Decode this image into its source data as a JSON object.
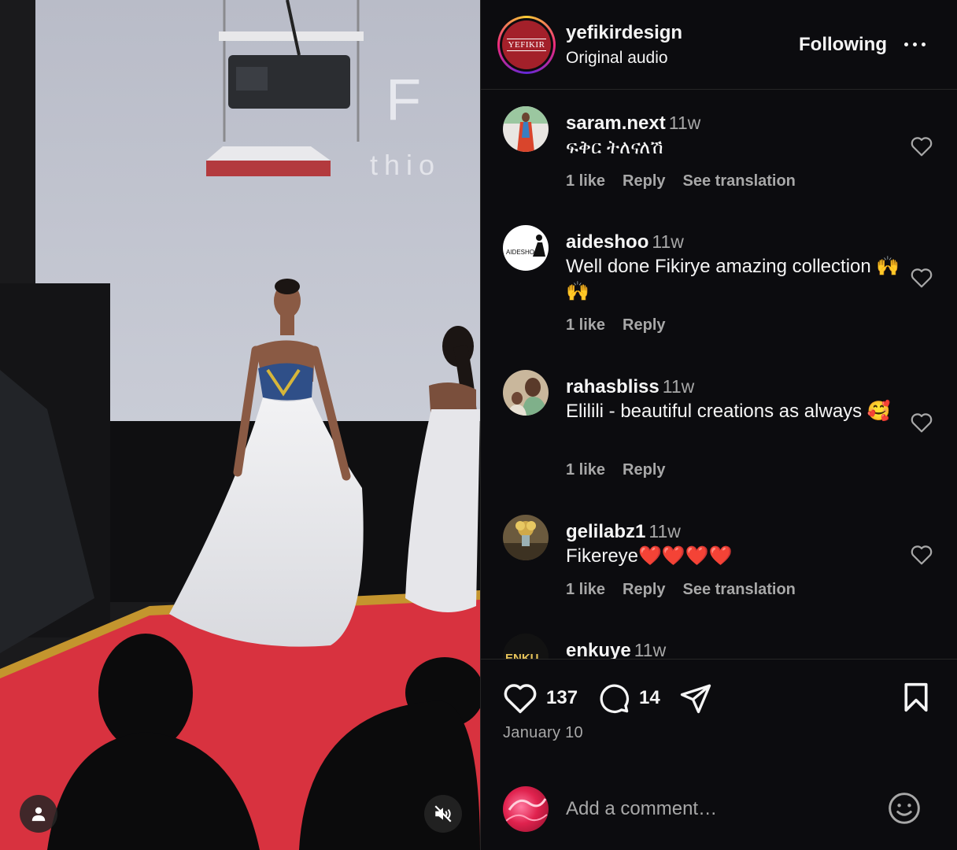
{
  "header": {
    "username": "yefikirdesign",
    "audio": "Original audio",
    "follow_label": "Following",
    "avatar_text": "YEFIKIR"
  },
  "video": {
    "backdrop_letters": "F I",
    "backdrop_sub": "thio",
    "tag_icon": "user-icon",
    "mute_icon": "speaker-muted-icon"
  },
  "comments": [
    {
      "user": "saram.next",
      "time": "11w",
      "text": "ፍቅር ትለናለሽ",
      "likes": "1 like",
      "reply": "Reply",
      "translate": "See translation"
    },
    {
      "user": "aideshoo",
      "time": "11w",
      "text": "Well done Fikirye amazing collection 🙌🙌",
      "likes": "1 like",
      "reply": "Reply",
      "translate": ""
    },
    {
      "user": "rahasbliss",
      "time": "11w",
      "text": "Elilili - beautiful creations as always 🥰",
      "likes": "1 like",
      "reply": "Reply",
      "translate": ""
    },
    {
      "user": "gelilabz1",
      "time": "11w",
      "text": "Fikereye❤️❤️❤️❤️",
      "likes": "1 like",
      "reply": "Reply",
      "translate": "See translation"
    },
    {
      "user": "enkuye",
      "time": "11w",
      "avatar_text": "ENKU"
    }
  ],
  "actions": {
    "likes_count": "137",
    "comments_count": "14",
    "date": "January 10"
  },
  "composer": {
    "placeholder": "Add a comment…"
  },
  "colors": {
    "panel_bg": "#0c0c0f",
    "muted_text": "#a8a8a8",
    "carpet": "#d8323f",
    "brand": "#a3202a"
  }
}
